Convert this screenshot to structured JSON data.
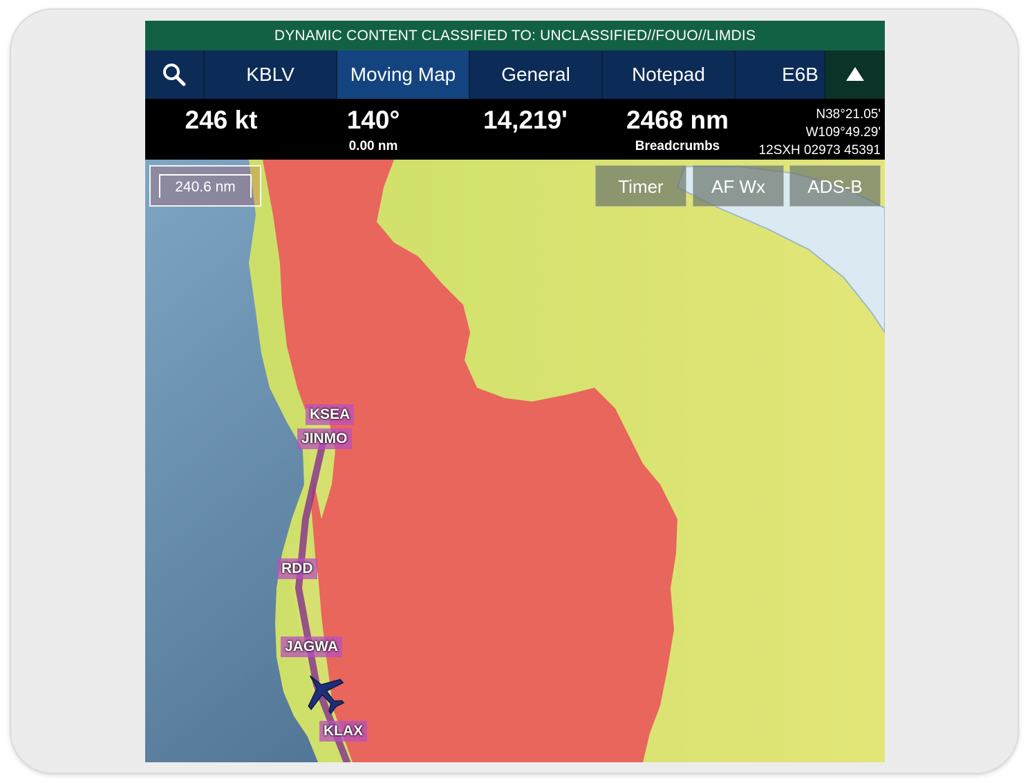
{
  "classification": "DYNAMIC CONTENT CLASSIFIED TO: UNCLASSIFIED//FOUO//LIMDIS",
  "nav": {
    "search_icon": "search-icon",
    "tabs": [
      "KBLV",
      "Moving Map",
      "General",
      "Notepad",
      "E6B"
    ],
    "active_tab": "Moving Map",
    "collapse_icon": "triangle-up-icon"
  },
  "status": {
    "speed": "246 kt",
    "heading": "140°",
    "heading_sub": "0.00 nm",
    "altitude": "14,219'",
    "distance": "2468 nm",
    "distance_sub": "Breadcrumbs",
    "lat": "N38°21.05'",
    "lon": "W109°49.29'",
    "mgrs": "12SXH 02973 45391"
  },
  "map": {
    "scale": "240.6 nm",
    "buttons": [
      "Timer",
      "AF Wx",
      "ADS-B"
    ],
    "waypoints": [
      "KSEA",
      "JINMO",
      "RDD",
      "JAGWA",
      "KLAX"
    ],
    "aircraft_icon": "aircraft-icon"
  },
  "colors": {
    "classbar": "#136145",
    "nav": "#0c2b57",
    "nav_active": "#14447f",
    "terrain_high": "#e8665c",
    "terrain_low": "#d6e070",
    "ocean": "#5c86a6",
    "route": "#8a3a8a"
  }
}
